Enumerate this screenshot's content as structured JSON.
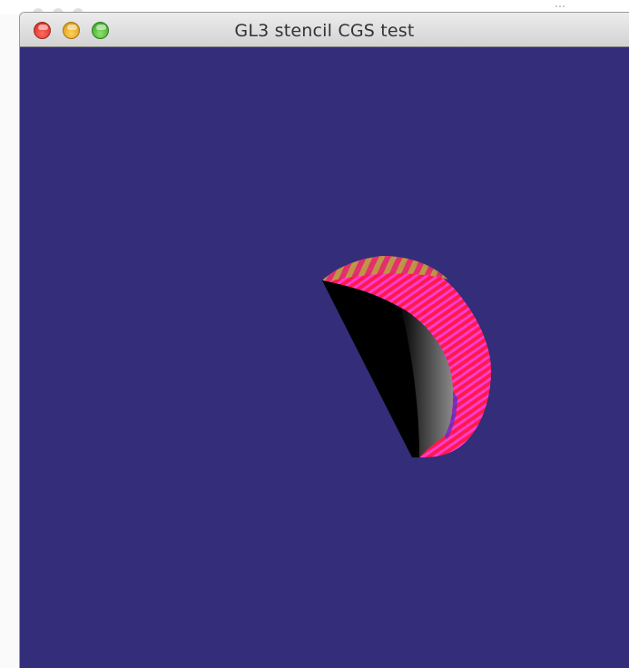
{
  "window": {
    "title": "GL3 stencil CGS test",
    "controls": [
      "close-button",
      "minimize-button",
      "zoom-button"
    ]
  },
  "viewport": {
    "background": "#342d79",
    "object": {
      "description_colors": [
        "#000000",
        "#ff2bb8",
        "#ff1f1f",
        "#6a9a3a"
      ]
    }
  },
  "colors": {
    "close": "#e0443a",
    "minimize": "#f2b232",
    "zoom": "#5cc53f",
    "clear_color": "#342d79"
  }
}
